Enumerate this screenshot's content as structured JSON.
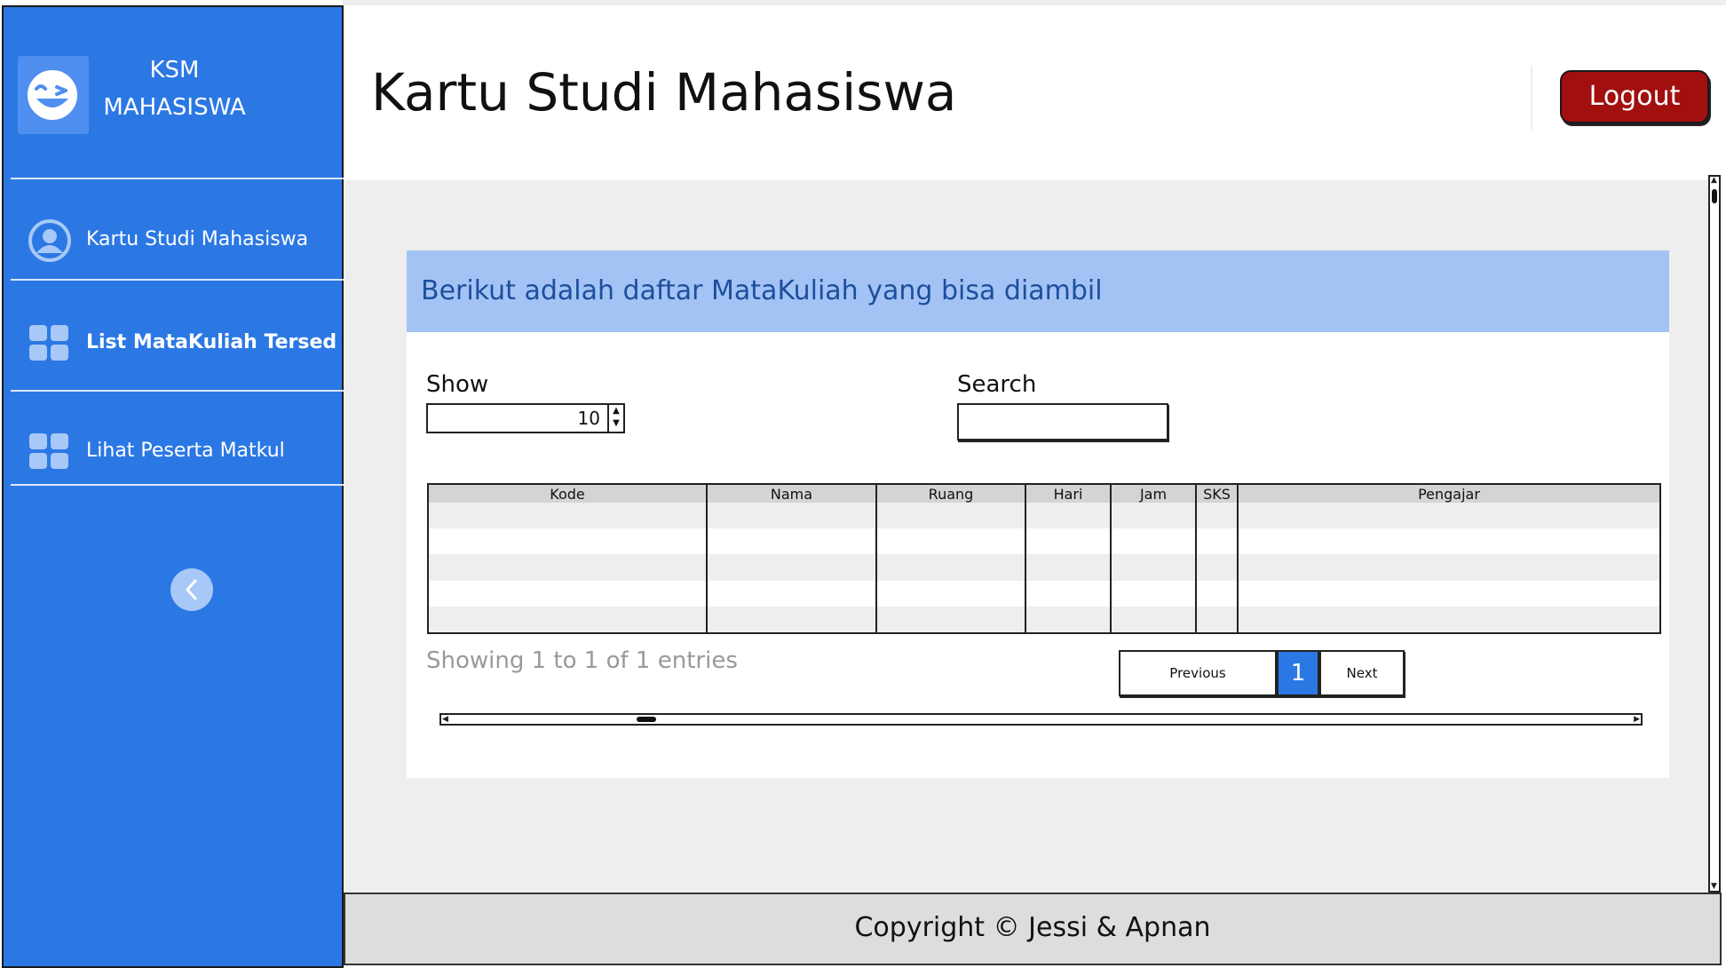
{
  "brand": {
    "line1": "KSM",
    "line2": "MAHASISWA",
    "logo_icon": "wink-smiley-icon"
  },
  "sidebar": {
    "items": [
      {
        "label": "Kartu Studi Mahasiswa",
        "icon": "user-icon",
        "active": false
      },
      {
        "label": "List MataKuliah Tersedia",
        "icon": "grid-icon",
        "active": true
      },
      {
        "label": "Lihat Peserta Matkul",
        "icon": "grid-icon",
        "active": false
      }
    ],
    "collapse_icon": "chevron-left-icon"
  },
  "header": {
    "title": "Kartu Studi Mahasiswa",
    "logout_label": "Logout"
  },
  "card": {
    "banner": "Berikut adalah daftar MataKuliah yang bisa diambil",
    "show_label": "Show",
    "show_value": "10",
    "search_label": "Search",
    "search_value": ""
  },
  "table": {
    "columns": [
      "Kode",
      "Nama",
      "Ruang",
      "Hari",
      "Jam",
      "SKS",
      "Pengajar"
    ]
  },
  "pagination": {
    "info": "Showing 1 to 1 of 1 entries",
    "previous": "Previous",
    "current_page": "1",
    "next": "Next"
  },
  "footer": {
    "text": "Copyright © Jessi & Apnan"
  },
  "colors": {
    "sidebar": "#2b78e4",
    "banner": "#a4c3f5",
    "banner_text": "#1c4f9c",
    "logout": "#a20f0f",
    "page_active": "#2b78e4"
  }
}
